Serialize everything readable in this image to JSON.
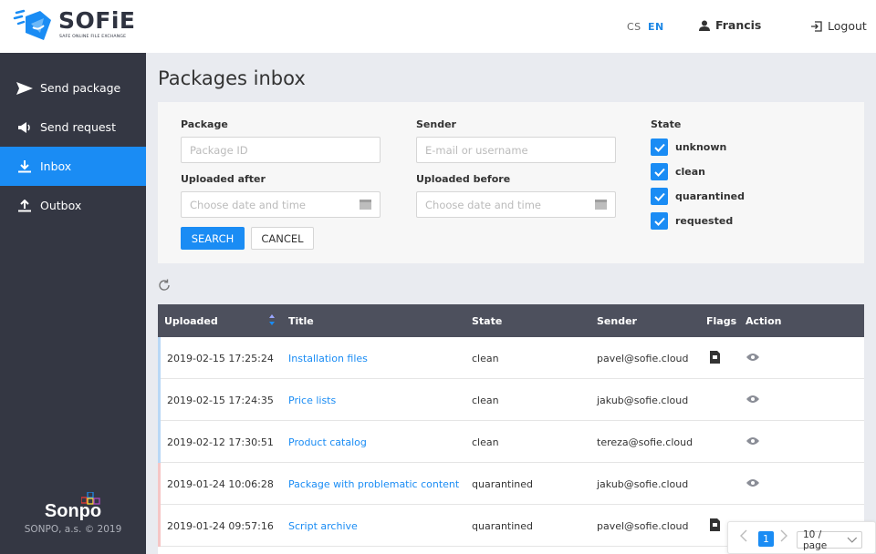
{
  "app": {
    "logo_text": "SOFiE",
    "logo_subtitle": "SAFE ONLINE FILE EXCHANGE"
  },
  "header": {
    "lang_cs": "CS",
    "lang_en": "EN",
    "user_name": "Francis",
    "logout_label": "Logout"
  },
  "sidebar": {
    "items": [
      {
        "label": "Send package",
        "icon": "send-icon"
      },
      {
        "label": "Send request",
        "icon": "megaphone-icon"
      },
      {
        "label": "Inbox",
        "icon": "download-icon",
        "active": true
      },
      {
        "label": "Outbox",
        "icon": "upload-icon"
      }
    ],
    "brand_name": "Sonpo",
    "brand_copyright": "SONPO, a.s. © 2019"
  },
  "page": {
    "title": "Packages inbox"
  },
  "filter": {
    "package_label": "Package",
    "package_placeholder": "Package ID",
    "sender_label": "Sender",
    "sender_placeholder": "E-mail or username",
    "uploaded_after_label": "Uploaded after",
    "uploaded_after_placeholder": "Choose date and time",
    "uploaded_before_label": "Uploaded before",
    "uploaded_before_placeholder": "Choose date and time",
    "state_label": "State",
    "states": [
      {
        "label": "unknown",
        "checked": true
      },
      {
        "label": "clean",
        "checked": true
      },
      {
        "label": "quarantined",
        "checked": true
      },
      {
        "label": "requested",
        "checked": true
      }
    ],
    "search_label": "SEARCH",
    "cancel_label": "CANCEL"
  },
  "table": {
    "columns": {
      "uploaded": "Uploaded",
      "title": "Title",
      "state": "State",
      "sender": "Sender",
      "flags": "Flags",
      "action": "Action"
    },
    "rows": [
      {
        "uploaded": "2019-02-15 17:25:24",
        "title": "Installation files",
        "state": "clean",
        "sender": "pavel@sofie.cloud",
        "flag": true
      },
      {
        "uploaded": "2019-02-15 17:24:35",
        "title": "Price lists",
        "state": "clean",
        "sender": "jakub@sofie.cloud",
        "flag": false
      },
      {
        "uploaded": "2019-02-12 17:30:51",
        "title": "Product catalog",
        "state": "clean",
        "sender": "tereza@sofie.cloud",
        "flag": false
      },
      {
        "uploaded": "2019-01-24 10:06:28",
        "title": "Package with problematic content",
        "state": "quarantined",
        "sender": "jakub@sofie.cloud",
        "flag": false
      },
      {
        "uploaded": "2019-01-24 09:57:16",
        "title": "Script archive",
        "state": "quarantined",
        "sender": "pavel@sofie.cloud",
        "flag": true
      }
    ]
  },
  "pagination": {
    "current_page": "1",
    "page_size": "10 / page"
  },
  "colors": {
    "accent": "#1a8cf4",
    "sidebar_bg": "#343743",
    "table_header_bg": "#4d505d",
    "clean_bar": "#b9d8f6",
    "quarantined_bar": "#f5c6c6"
  }
}
